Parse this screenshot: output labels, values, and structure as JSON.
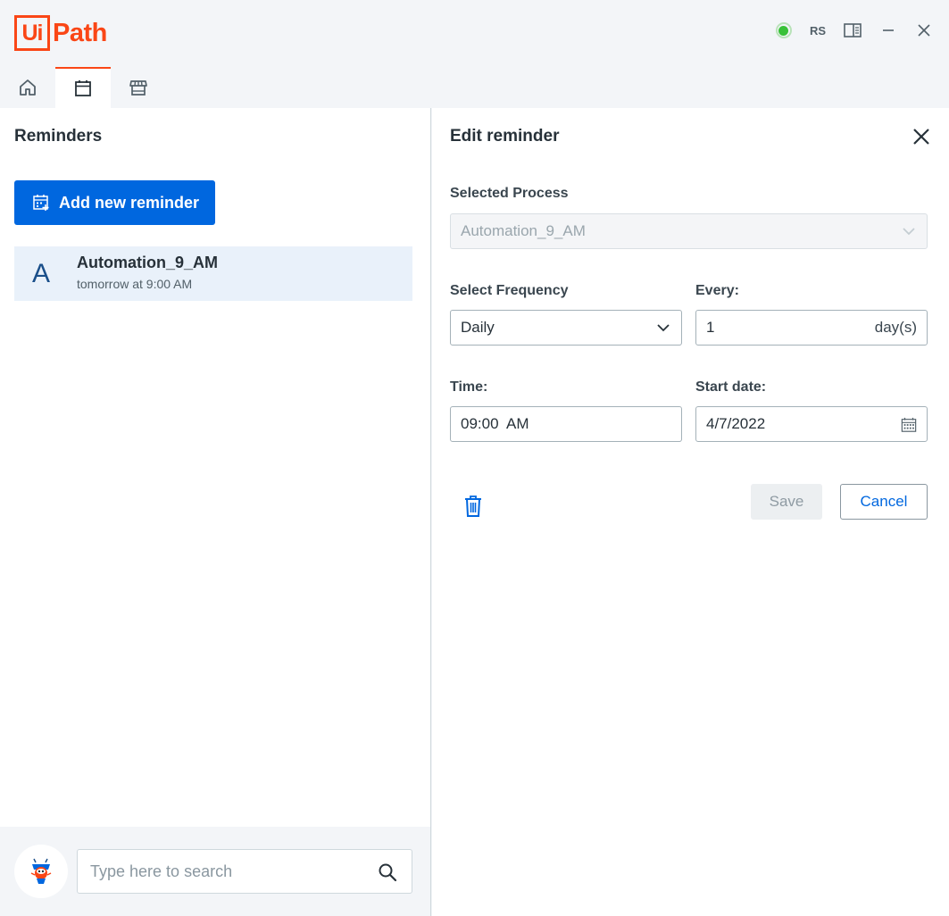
{
  "app": {
    "logo_box": "Ui",
    "logo_text": "Path",
    "user_initials": "RS",
    "brand_color": "#fa4616",
    "status_color": "#38c138"
  },
  "tabs": [
    {
      "icon": "home-icon",
      "active": false
    },
    {
      "icon": "calendar-icon",
      "active": true
    },
    {
      "icon": "store-icon",
      "active": false
    }
  ],
  "reminders": {
    "title": "Reminders",
    "add_label": "Add new reminder",
    "items": [
      {
        "avatar": "A",
        "name": "Automation_9_AM",
        "when": "tomorrow at 9:00 AM"
      }
    ]
  },
  "search": {
    "placeholder": "Type here to search"
  },
  "edit": {
    "title": "Edit reminder",
    "process_label": "Selected Process",
    "process_value": "Automation_9_AM",
    "frequency_label": "Select Frequency",
    "frequency_value": "Daily",
    "every_label": "Every:",
    "every_value": "1",
    "every_unit": "day(s)",
    "time_label": "Time:",
    "time_value": "09:00  AM",
    "start_label": "Start date:",
    "start_value": "4/7/2022",
    "save_label": "Save",
    "cancel_label": "Cancel"
  },
  "accent_color": "#0067df"
}
